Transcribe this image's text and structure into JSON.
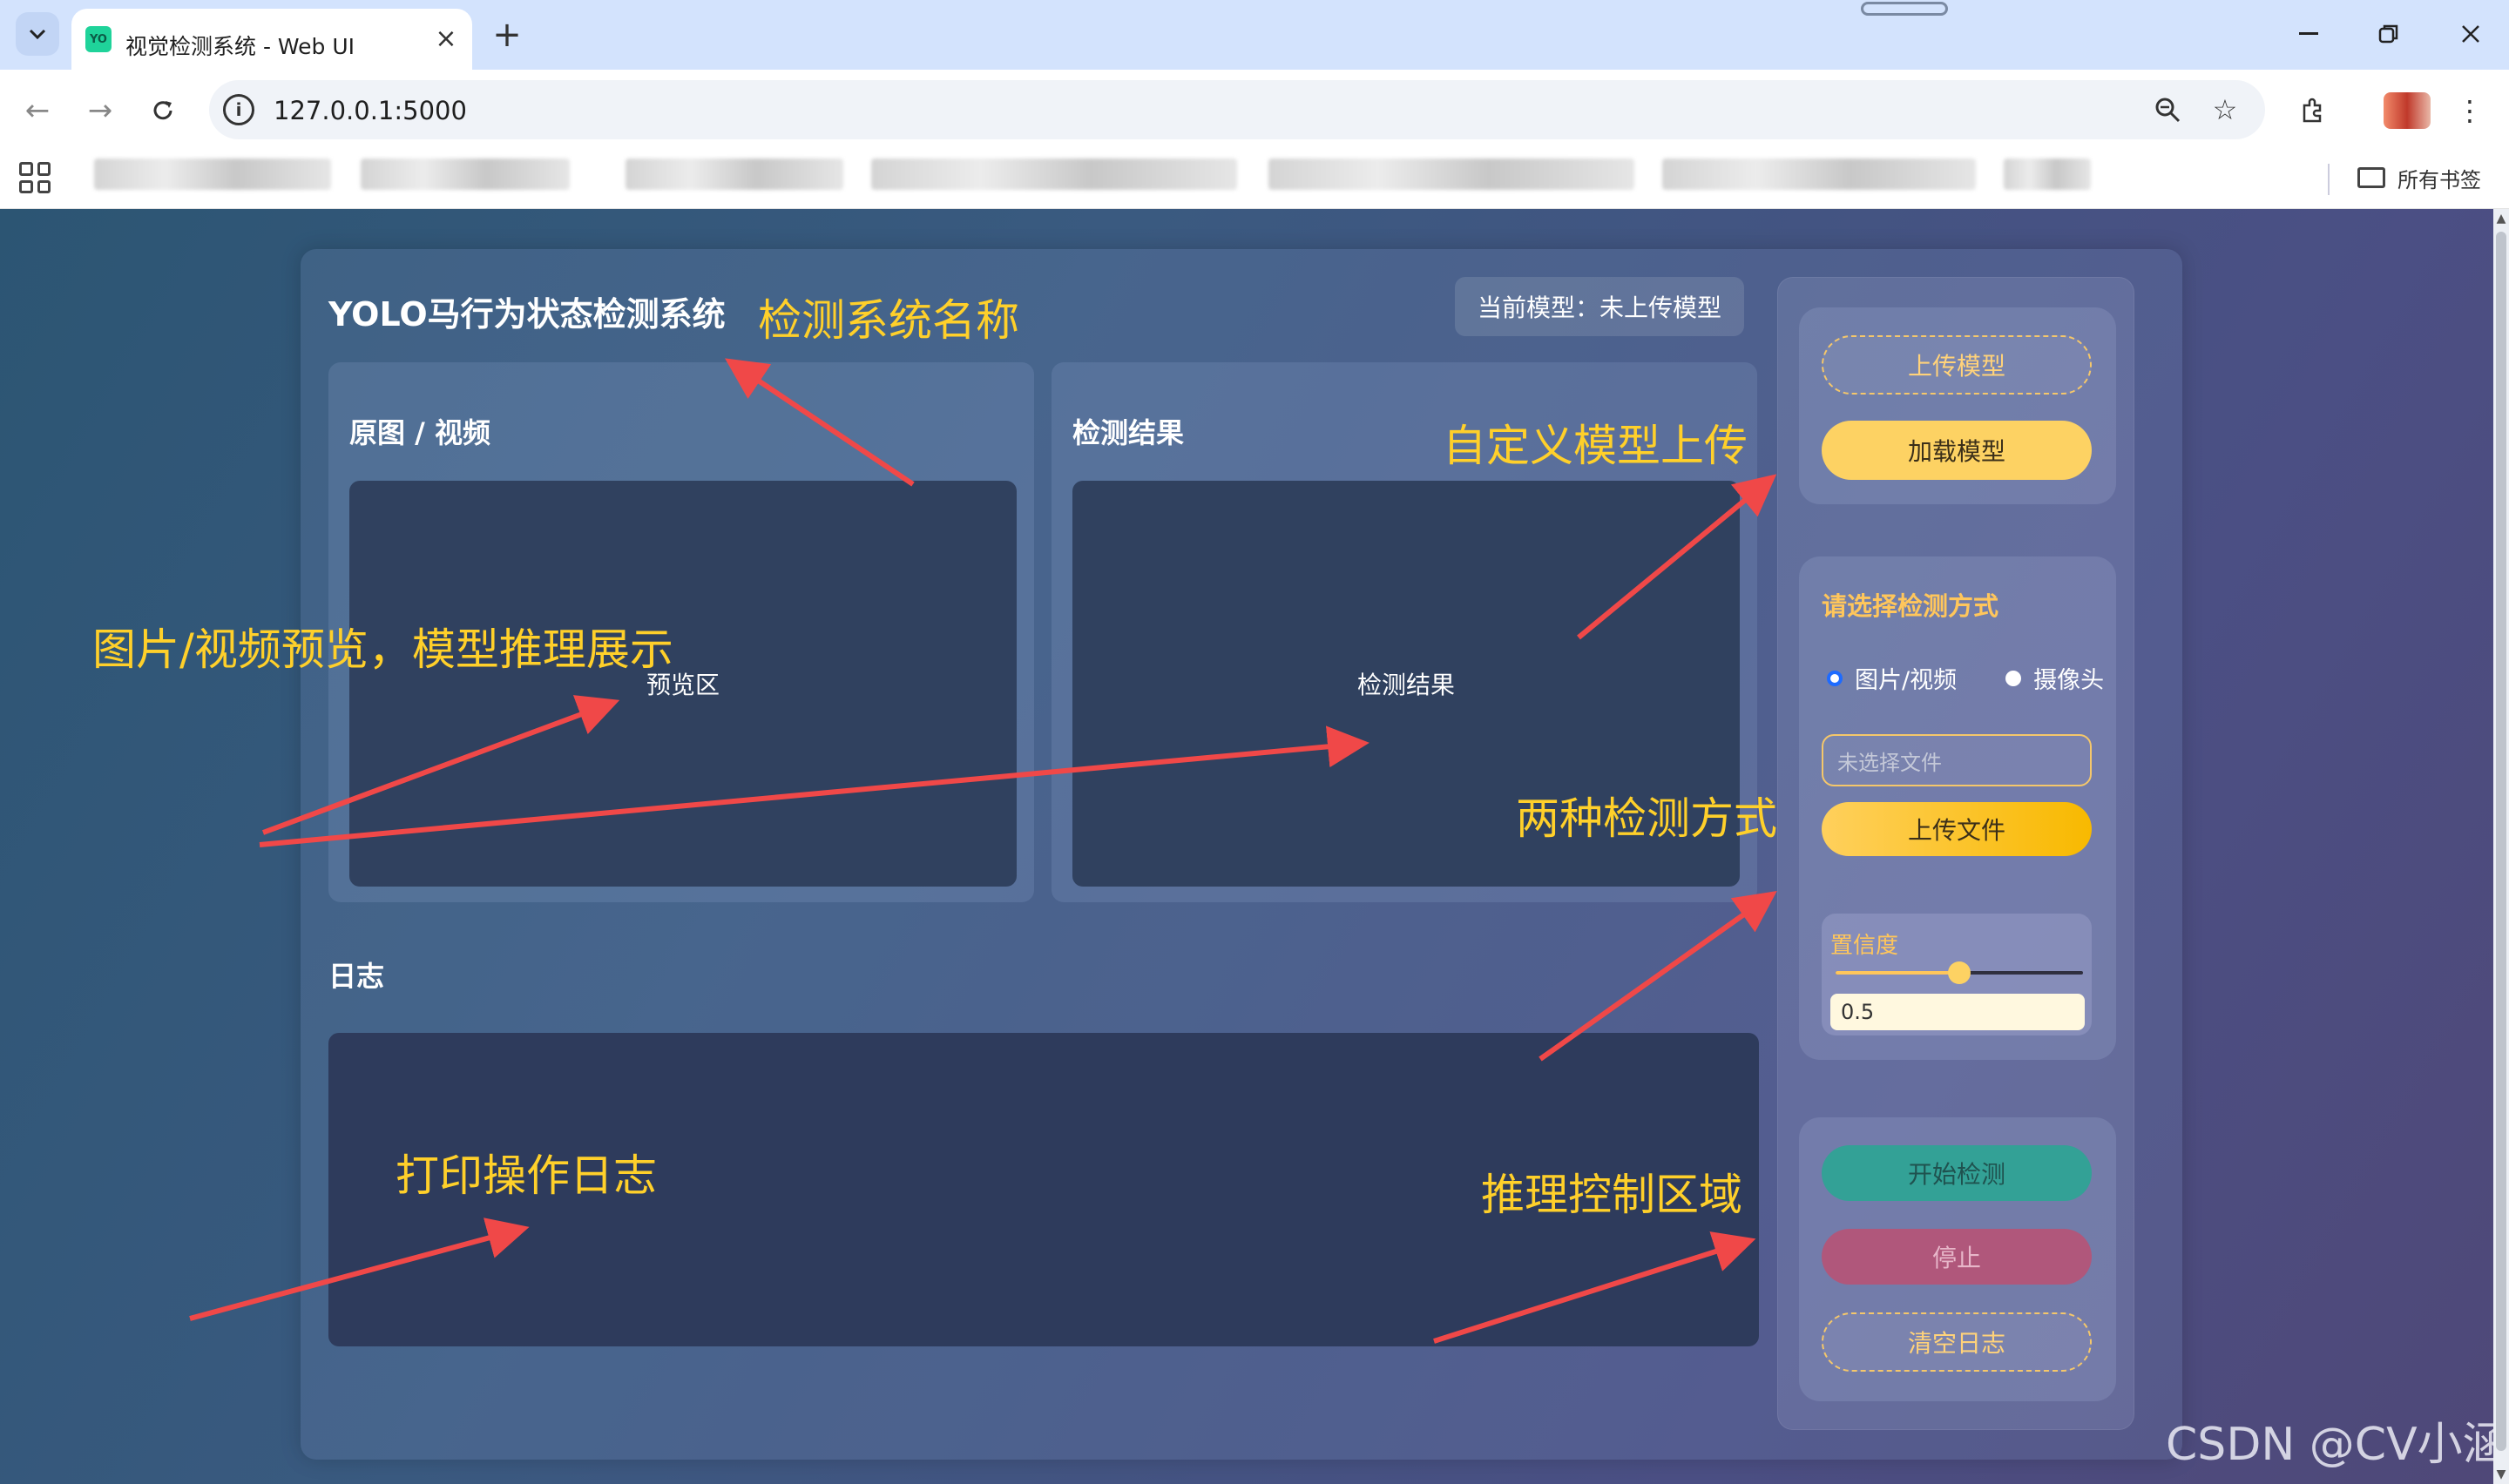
{
  "browser": {
    "tab_title": "视觉检测系统 - Web UI",
    "tab_favicon_text": "YO",
    "url": "127.0.0.1:5000",
    "all_bookmarks_label": "所有书签",
    "icons": [
      "tab-search-icon",
      "close-icon",
      "plus-icon",
      "back-icon",
      "forward-icon",
      "reload-icon",
      "site-info-icon",
      "zoom-icon",
      "star-icon",
      "extensions-icon",
      "more-icon",
      "apps-icon",
      "folder-icon",
      "minimize-icon",
      "restore-icon",
      "window-close-icon"
    ]
  },
  "app": {
    "title": "YOLO马行为状态检测系统",
    "current_model": "当前模型：未上传模型",
    "left_panel_title": "原图 / 视频",
    "left_panel_placeholder": "预览区",
    "right_panel_title": "检测结果",
    "right_panel_placeholder": "检测结果",
    "log_title": "日志"
  },
  "sidebar": {
    "upload_model": "上传模型",
    "load_model": "加载模型",
    "mode_title": "请选择检测方式",
    "modes": [
      {
        "label": "图片/视频",
        "selected": true
      },
      {
        "label": "摄像头",
        "selected": false
      }
    ],
    "file_placeholder": "未选择文件",
    "upload_file": "上传文件",
    "confidence_label": "置信度",
    "confidence_value": "0.5",
    "confidence": 0.5,
    "start": "开始检测",
    "stop": "停止",
    "clear_log": "清空日志"
  },
  "annotations": {
    "name": "检测系统名称",
    "model_upload": "自定义模型上传",
    "preview": "图片/视频预览，模型推理展示",
    "modes": "两种检测方式",
    "log": "打印操作日志",
    "control": "推理控制区域"
  },
  "colors": {
    "accent_yellow": "#fdd263",
    "annotation_yellow": "#ffd02a",
    "arrow_red": "#f04848",
    "start_teal": "#33a196",
    "stop_pink": "#b0577b"
  },
  "watermark": "CSDN @CV小涵"
}
